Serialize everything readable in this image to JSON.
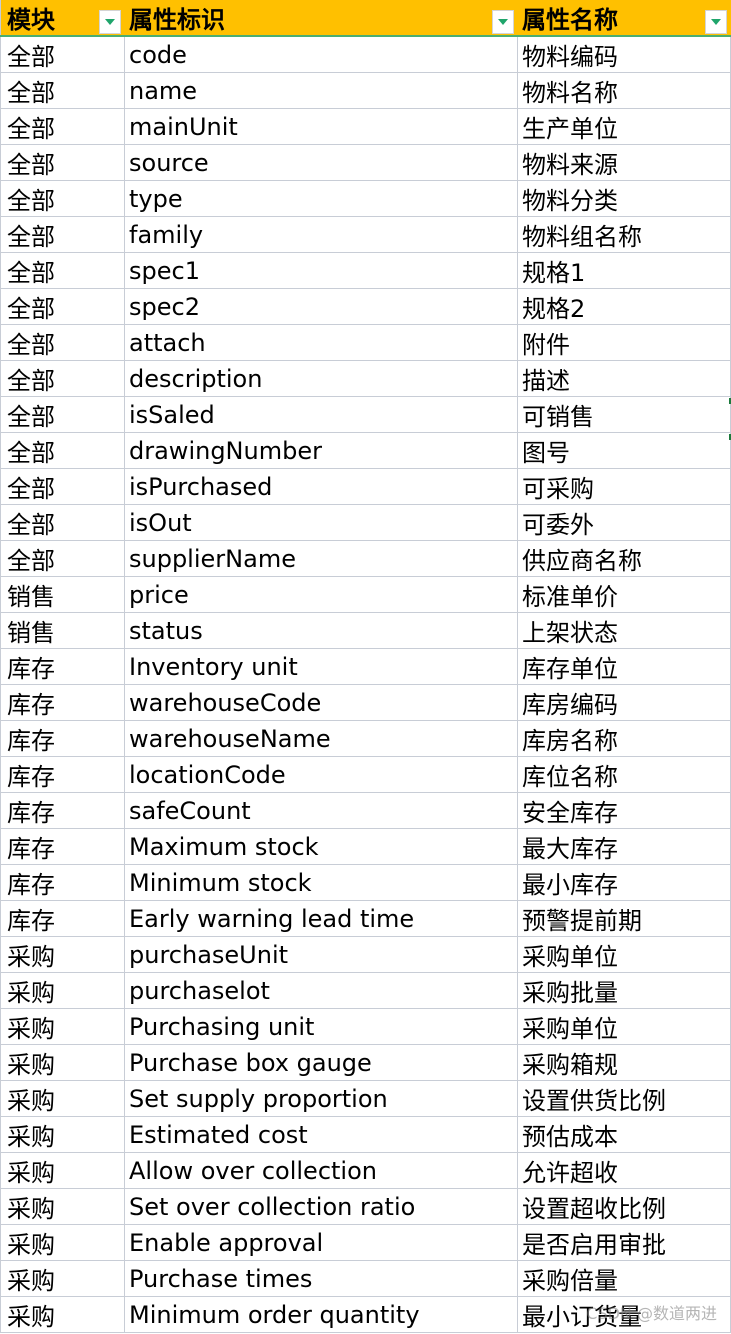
{
  "table": {
    "headers": [
      "模块",
      "属性标识",
      "属性名称"
    ],
    "rows": [
      [
        "全部",
        "code",
        "物料编码"
      ],
      [
        "全部",
        "name",
        "物料名称"
      ],
      [
        "全部",
        "mainUnit",
        "生产单位"
      ],
      [
        "全部",
        "source",
        "物料来源"
      ],
      [
        "全部",
        "type",
        "物料分类"
      ],
      [
        "全部",
        "family",
        "物料组名称"
      ],
      [
        "全部",
        "spec1",
        "规格1"
      ],
      [
        "全部",
        "spec2",
        "规格2"
      ],
      [
        "全部",
        "attach",
        "附件"
      ],
      [
        "全部",
        "description",
        "描述"
      ],
      [
        "全部",
        "isSaled",
        "可销售"
      ],
      [
        "全部",
        "drawingNumber",
        "图号"
      ],
      [
        "全部",
        "isPurchased",
        "可采购"
      ],
      [
        "全部",
        "isOut",
        "可委外"
      ],
      [
        "全部",
        "supplierName",
        "供应商名称"
      ],
      [
        "销售",
        "price",
        "标准单价"
      ],
      [
        "销售",
        "status",
        "上架状态"
      ],
      [
        "库存",
        "Inventory unit",
        "库存单位"
      ],
      [
        "库存",
        "warehouseCode",
        "库房编码"
      ],
      [
        "库存",
        "warehouseName",
        "库房名称"
      ],
      [
        "库存",
        "locationCode",
        "库位名称"
      ],
      [
        "库存",
        "safeCount",
        "安全库存"
      ],
      [
        "库存",
        "Maximum stock",
        "最大库存"
      ],
      [
        "库存",
        "Minimum stock",
        "最小库存"
      ],
      [
        "库存",
        "Early warning lead time",
        "预警提前期"
      ],
      [
        "采购",
        "purchaseUnit",
        "采购单位"
      ],
      [
        "采购",
        "purchaselot",
        "采购批量"
      ],
      [
        "采购",
        "Purchasing unit",
        "采购单位"
      ],
      [
        "采购",
        "Purchase box gauge",
        "采购箱规"
      ],
      [
        "采购",
        "Set supply proportion",
        "设置供货比例"
      ],
      [
        "采购",
        "Estimated cost",
        "预估成本"
      ],
      [
        "采购",
        "Allow over collection",
        "允许超收"
      ],
      [
        "采购",
        "Set over collection ratio",
        "设置超收比例"
      ],
      [
        "采购",
        "Enable approval",
        "是否启用审批"
      ],
      [
        "采购",
        "Purchase times",
        "采购倍量"
      ],
      [
        "采购",
        "Minimum order quantity",
        "最小订货量"
      ]
    ]
  },
  "icons": {
    "filter": "filter-dropdown-icon"
  },
  "colors": {
    "header_bg": "#ffc000",
    "filter_arrow": "#1fa56b",
    "grid": "#c8cdd6"
  },
  "watermark": "CSDN @数道两进"
}
